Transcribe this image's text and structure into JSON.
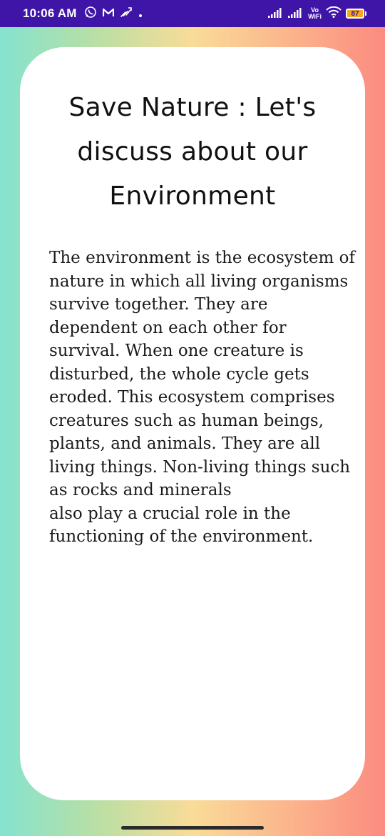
{
  "status_bar": {
    "time": "10:06 AM",
    "left_icons": [
      "whatsapp-icon",
      "gmail-icon",
      "app-notification-icon",
      "dot-icon"
    ],
    "right_icons": [
      "signal-icon",
      "signal-icon",
      "vowifi-icon",
      "wifi-icon",
      "battery-icon"
    ],
    "vowifi_line1": "Vo",
    "vowifi_line2": "WiFi",
    "battery_level": "87",
    "background_color": "#3f15a8"
  },
  "card": {
    "title": "Save Nature : Let's discuss about our Environment",
    "body": " The environment is the ecosystem of nature in which all living organisms survive together. They are dependent on each other for survival. When one creature is disturbed, the whole cycle gets eroded. This ecosystem comprises creatures such as human beings, plants, and animals. They are all living things. Non-living things such as rocks and minerals\nalso play a crucial role in the functioning of the environment."
  },
  "colors": {
    "gradient": [
      "#84e3d0",
      "#b9dfa4",
      "#f9dc98",
      "#fbb58c",
      "#fb8b80"
    ],
    "card_background": "#ffffff"
  }
}
